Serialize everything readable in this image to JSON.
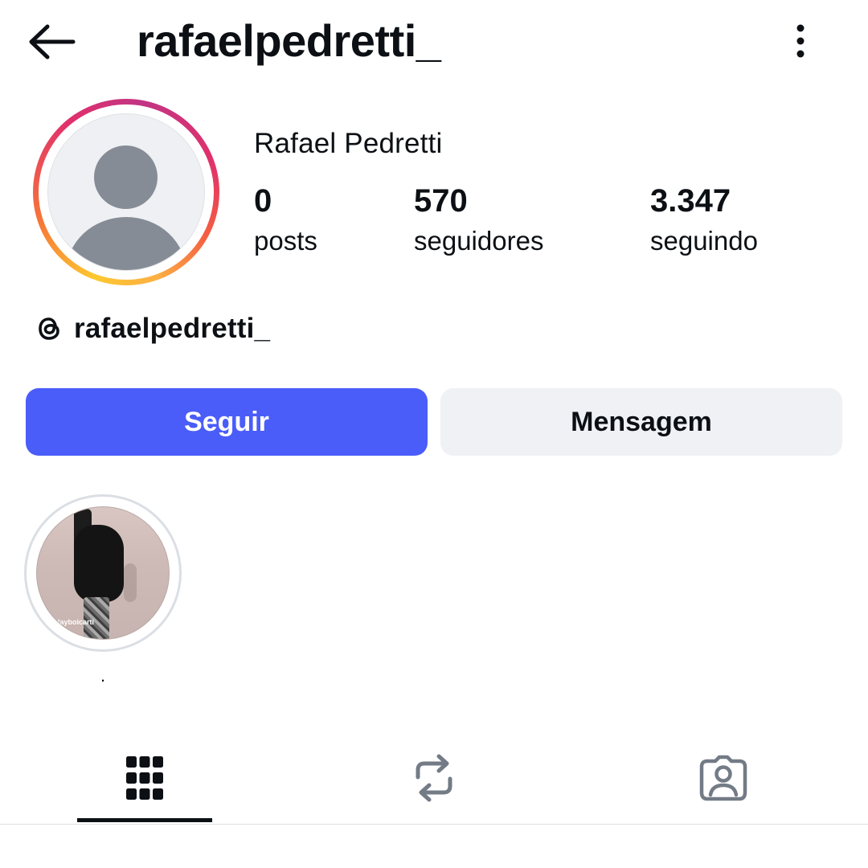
{
  "header": {
    "username": "rafaelpedretti_",
    "back_icon": "arrow-left-icon",
    "more_icon": "more-vertical-icon"
  },
  "profile": {
    "full_name": "Rafael Pedretti",
    "avatar_icon": "default-avatar-icon",
    "stats": [
      {
        "value": "0",
        "label": "posts"
      },
      {
        "value": "570",
        "label": "seguidores"
      },
      {
        "value": "3.347",
        "label": "seguindo"
      }
    ],
    "threads": {
      "icon": "threads-icon",
      "username": "rafaelpedretti_"
    }
  },
  "actions": {
    "follow_label": "Seguir",
    "message_label": "Mensagem"
  },
  "highlights": [
    {
      "label": ".",
      "image_caption": "layboicarti\nhts"
    }
  ],
  "tabs": [
    {
      "icon": "grid-icon",
      "active": true
    },
    {
      "icon": "repost-icon",
      "active": false
    },
    {
      "icon": "tagged-icon",
      "active": false
    }
  ],
  "colors": {
    "follow_button": "#4a5df9",
    "message_button": "#eff1f5",
    "text": "#0c1014",
    "tab_inactive": "#737b86"
  }
}
